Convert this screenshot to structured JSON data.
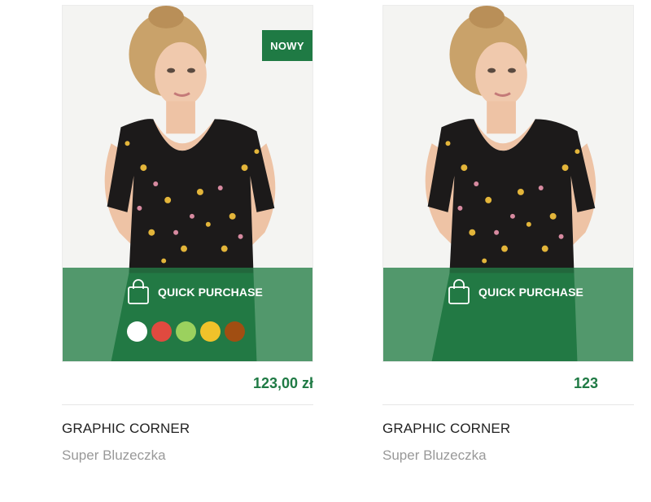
{
  "colors": {
    "accent": "#1f7a44",
    "overlay": "rgba(36,126,71,0.78)"
  },
  "products": [
    {
      "badge": "NOWY",
      "quick_purchase_label": "QUICK PURCHASE",
      "quick_purchase_icon": "shopping-bag-icon",
      "swatches": [
        "#ffffff",
        "#e04a3f",
        "#9bd15e",
        "#f0c22a",
        "#a14e12"
      ],
      "price": "123,00 zł",
      "brand": "GRAPHIC CORNER",
      "name": "Super Bluzeczka"
    },
    {
      "badge": "",
      "quick_purchase_label": "QUICK PURCHASE",
      "quick_purchase_icon": "shopping-bag-icon",
      "swatches": [],
      "price": "123",
      "brand": "GRAPHIC CORNER",
      "name": "Super Bluzeczka"
    }
  ]
}
